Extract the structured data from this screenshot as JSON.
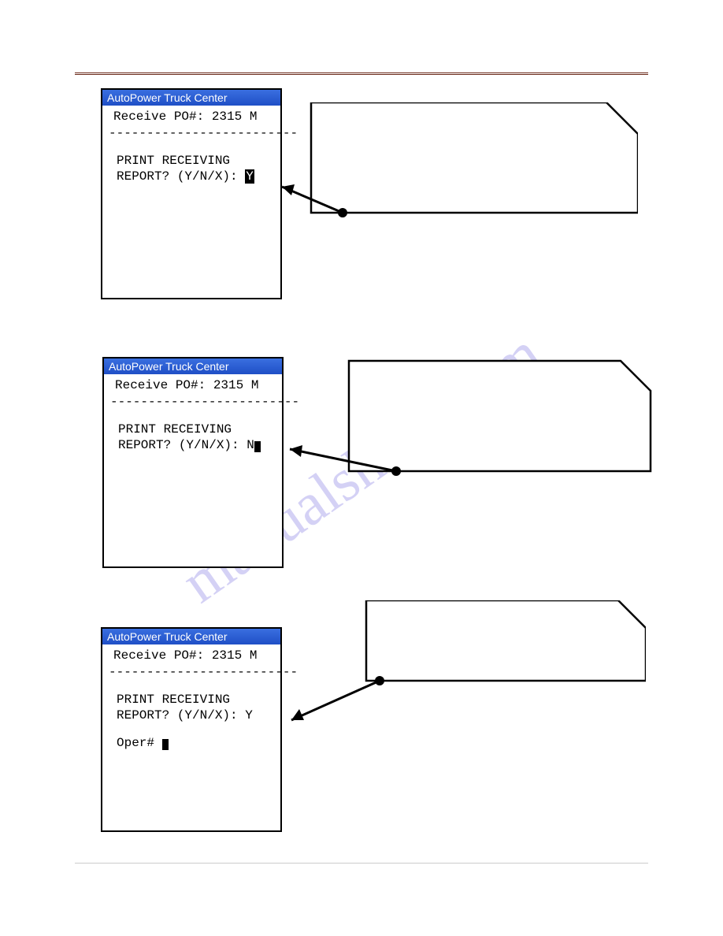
{
  "watermark": "manualshive.com",
  "windows": {
    "w1": {
      "title": "AutoPower Truck Center",
      "header": "Receive PO#: 2315  M",
      "separator": "-------------------------",
      "line1": "PRINT RECEIVING",
      "line2_pre": "REPORT? (Y/N/X): ",
      "answer": "Y"
    },
    "w2": {
      "title": "AutoPower Truck Center",
      "header": "Receive PO#: 2315  M",
      "separator": "-------------------------",
      "line1": "PRINT RECEIVING",
      "line2_pre": "REPORT? (Y/N/X): ",
      "answer": "N"
    },
    "w3": {
      "title": "AutoPower Truck Center",
      "header": "Receive PO#: 2315  M",
      "separator": "-------------------------",
      "line1": "PRINT RECEIVING",
      "line2_pre": "REPORT? (Y/N/X): Y",
      "oper": "Oper# "
    }
  }
}
